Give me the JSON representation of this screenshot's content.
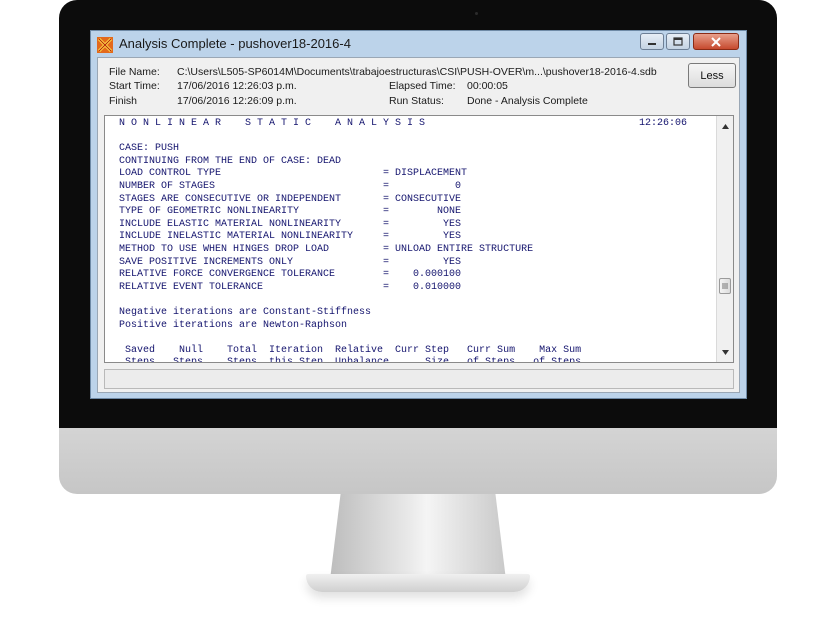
{
  "window": {
    "title": "Analysis Complete - pushover18-2016-4",
    "minimize_icon": "minimize-icon",
    "maximize_icon": "maximize-icon",
    "close_icon": "close-icon",
    "app_icon": "sap2000-icon"
  },
  "info": {
    "file_label": "File Name:",
    "file_value": "C:\\Users\\L505-SP6014M\\Documents\\trabajoestructuras\\CSI\\PUSH-OVER\\m...\\pushover18-2016-4.sdb",
    "start_label": "Start Time:",
    "start_value": "17/06/2016 12:26:03 p.m.",
    "finish_label": "Finish",
    "finish_value": "17/06/2016 12:26:09 p.m.",
    "elapsed_label": "Elapsed Time:",
    "elapsed_value": "00:00:05",
    "status_label": "Run Status:",
    "status_value": "Done - Analysis Complete"
  },
  "buttons": {
    "less": "Less"
  },
  "log": {
    "header_title": "N O N L I N E A R    S T A T I C    A N A L Y S I S",
    "header_time": "12:26:06",
    "lines": [
      "",
      "CASE: PUSH",
      "CONTINUING FROM THE END OF CASE: DEAD",
      "LOAD CONTROL TYPE                           = DISPLACEMENT",
      "NUMBER OF STAGES                            =           0",
      "STAGES ARE CONSECUTIVE OR INDEPENDENT       = CONSECUTIVE",
      "TYPE OF GEOMETRIC NONLINEARITY              =        NONE",
      "INCLUDE ELASTIC MATERIAL NONLINEARITY       =         YES",
      "INCLUDE INELASTIC MATERIAL NONLINEARITY     =         YES",
      "METHOD TO USE WHEN HINGES DROP LOAD         = UNLOAD ENTIRE STRUCTURE",
      "SAVE POSITIVE INCREMENTS ONLY               =         YES",
      "RELATIVE FORCE CONVERGENCE TOLERANCE        =    0.000100",
      "RELATIVE EVENT TOLERANCE                    =    0.010000",
      "",
      "Negative iterations are Constant-Stiffness",
      "Positive iterations are Newton-Raphson",
      "",
      " Saved    Null    Total  Iteration  Relative  Curr Step   Curr Sum    Max Sum",
      " Steps   Steps    Steps  this Step  Unbalance      Size   of Steps   of Steps"
    ]
  },
  "scrollbar": {
    "up_icon": "scroll-up-arrow-icon",
    "down_icon": "scroll-down-arrow-icon",
    "thumb_icon": "scroll-thumb-grip-icon"
  }
}
